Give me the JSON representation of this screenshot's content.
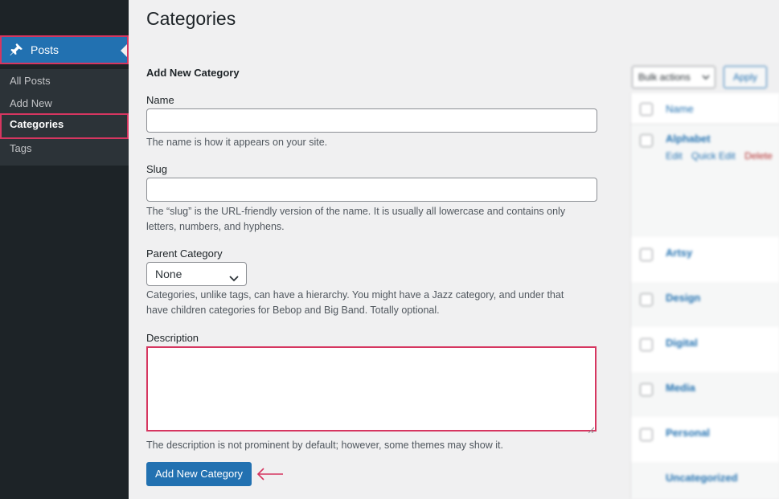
{
  "sidebar": {
    "posts_label": "Posts",
    "items": [
      {
        "label": "All Posts"
      },
      {
        "label": "Add New"
      },
      {
        "label": "Categories"
      },
      {
        "label": "Tags"
      }
    ]
  },
  "page": {
    "title": "Categories"
  },
  "form": {
    "section_title": "Add New Category",
    "name_label": "Name",
    "name_value": "",
    "name_help": "The name is how it appears on your site.",
    "slug_label": "Slug",
    "slug_value": "",
    "slug_help_1": "The “slug” is the URL-friendly version of the name. It is usually all lowercase and contains only",
    "slug_help_2": "letters, numbers, and hyphens.",
    "parent_label": "Parent Category",
    "parent_selected": "None",
    "parent_help_1": "Categories, unlike tags, can have a hierarchy. You might have a Jazz category, and under that",
    "parent_help_2": "have children categories for Bebop and Big Band. Totally optional.",
    "description_label": "Description",
    "description_value": "",
    "description_help": "The description is not prominent by default; however, some themes may show it.",
    "submit_label": "Add New Category"
  },
  "list": {
    "bulk_actions_label": "Bulk actions",
    "apply_label": "Apply",
    "column_name": "Name",
    "row_actions": {
      "edit": "Edit",
      "quick_edit": "Quick Edit",
      "delete": "Delete"
    },
    "rows": [
      {
        "name": "Alphabet"
      },
      {
        "name": "Artsy"
      },
      {
        "name": "Design"
      },
      {
        "name": "Digital"
      },
      {
        "name": "Media"
      },
      {
        "name": "Personal"
      },
      {
        "name": "Uncategorized"
      }
    ]
  },
  "colors": {
    "accent": "#2271b1",
    "highlight": "#d63660",
    "sidebar": "#1d2327",
    "submenu": "#2c3338",
    "background": "#f0f0f1"
  },
  "icons": {
    "posts": "pushpin-icon",
    "pointer": "arrow-left-icon",
    "dropdown": "chevron-down-icon"
  }
}
